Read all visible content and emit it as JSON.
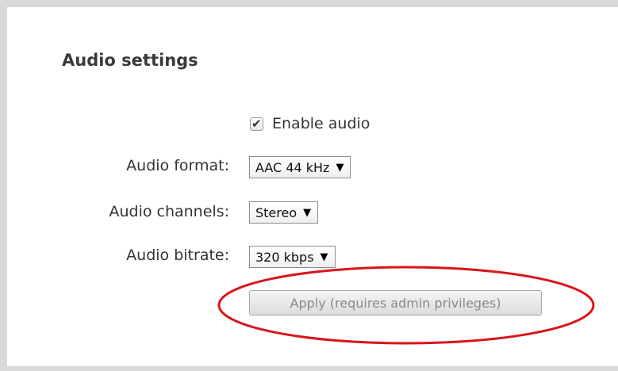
{
  "section": {
    "title": "Audio settings"
  },
  "enable_audio": {
    "label": "Enable audio",
    "checked": true,
    "check_icon": "checkmark-icon"
  },
  "fields": {
    "format": {
      "label": "Audio format:",
      "value": "AAC 44 kHz"
    },
    "channels": {
      "label": "Audio channels:",
      "value": "Stereo"
    },
    "bitrate": {
      "label": "Audio bitrate:",
      "value": "320 kbps"
    }
  },
  "dropdown_arrow": "▼",
  "apply_button": {
    "label": "Apply (requires admin privileges)",
    "enabled": false
  },
  "annotation": {
    "color": "#d9141b"
  }
}
